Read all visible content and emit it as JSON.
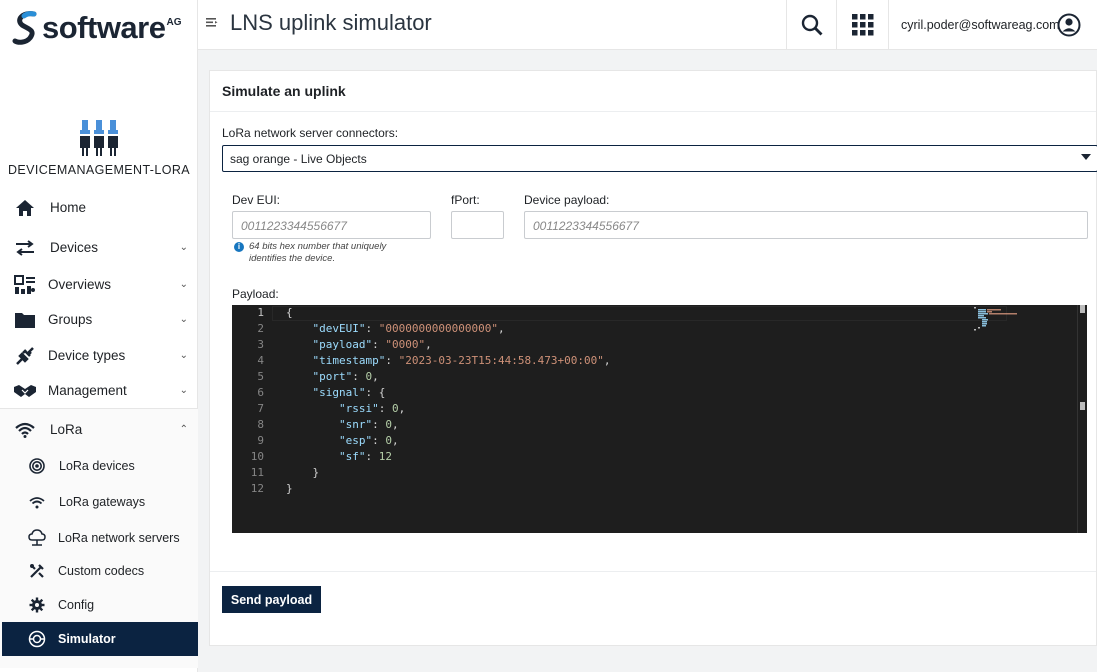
{
  "brand": {
    "name": "software",
    "suffix": "AG"
  },
  "app": {
    "name": "DEVICEMANAGEMENT-LORA"
  },
  "header": {
    "title": "LNS uplink simulator",
    "user_email": "cyril.poder@softwareag.com"
  },
  "sidebar": {
    "items": [
      {
        "label": "Home",
        "icon": "home-icon"
      },
      {
        "label": "Devices",
        "icon": "swap-arrows-icon"
      },
      {
        "label": "Overviews",
        "icon": "dashboard-icon"
      },
      {
        "label": "Groups",
        "icon": "folder-icon"
      },
      {
        "label": "Device types",
        "icon": "plug-icon"
      },
      {
        "label": "Management",
        "icon": "handshake-icon"
      },
      {
        "label": "LoRa",
        "icon": "wifi-icon"
      }
    ],
    "lora_items": [
      {
        "label": "LoRa devices",
        "icon": "target-icon"
      },
      {
        "label": "LoRa gateways",
        "icon": "wifi-icon"
      },
      {
        "label": "LoRa network servers",
        "icon": "cloud-icon"
      },
      {
        "label": "Custom codecs",
        "icon": "tools-icon"
      },
      {
        "label": "Config",
        "icon": "gear-icon"
      },
      {
        "label": "Simulator",
        "icon": "simulator-icon"
      }
    ]
  },
  "form": {
    "section_title": "Simulate an uplink",
    "connector_label": "LoRa network server connectors:",
    "connector_value": "sag orange - Live Objects",
    "dev_eui_label": "Dev EUI:",
    "dev_eui_placeholder": "0011223344556677",
    "dev_eui_hint": "64 bits hex number that uniquely identifies the device.",
    "fport_label": "fPort:",
    "fport_value": "",
    "payload_device_label": "Device payload:",
    "payload_device_placeholder": "0011223344556677",
    "payload_label": "Payload:",
    "send_label": "Send payload"
  },
  "editor": {
    "line_numbers": [
      "1",
      "2",
      "3",
      "4",
      "5",
      "6",
      "7",
      "8",
      "9",
      "10",
      "11",
      "12"
    ],
    "current_line": 1,
    "tokens": [
      [
        {
          "t": "p",
          "v": "{"
        }
      ],
      [
        {
          "t": "p",
          "v": "    "
        },
        {
          "t": "k",
          "v": "\"devEUI\""
        },
        {
          "t": "p",
          "v": ": "
        },
        {
          "t": "s",
          "v": "\"0000000000000000\""
        },
        {
          "t": "p",
          "v": ","
        }
      ],
      [
        {
          "t": "p",
          "v": "    "
        },
        {
          "t": "k",
          "v": "\"payload\""
        },
        {
          "t": "p",
          "v": ": "
        },
        {
          "t": "s",
          "v": "\"0000\""
        },
        {
          "t": "p",
          "v": ","
        }
      ],
      [
        {
          "t": "p",
          "v": "    "
        },
        {
          "t": "k",
          "v": "\"timestamp\""
        },
        {
          "t": "p",
          "v": ": "
        },
        {
          "t": "s",
          "v": "\"2023-03-23T15:44:58.473+00:00\""
        },
        {
          "t": "p",
          "v": ","
        }
      ],
      [
        {
          "t": "p",
          "v": "    "
        },
        {
          "t": "k",
          "v": "\"port\""
        },
        {
          "t": "p",
          "v": ": "
        },
        {
          "t": "n",
          "v": "0"
        },
        {
          "t": "p",
          "v": ","
        }
      ],
      [
        {
          "t": "p",
          "v": "    "
        },
        {
          "t": "k",
          "v": "\"signal\""
        },
        {
          "t": "p",
          "v": ": {"
        }
      ],
      [
        {
          "t": "p",
          "v": "        "
        },
        {
          "t": "k",
          "v": "\"rssi\""
        },
        {
          "t": "p",
          "v": ": "
        },
        {
          "t": "n",
          "v": "0"
        },
        {
          "t": "p",
          "v": ","
        }
      ],
      [
        {
          "t": "p",
          "v": "        "
        },
        {
          "t": "k",
          "v": "\"snr\""
        },
        {
          "t": "p",
          "v": ": "
        },
        {
          "t": "n",
          "v": "0"
        },
        {
          "t": "p",
          "v": ","
        }
      ],
      [
        {
          "t": "p",
          "v": "        "
        },
        {
          "t": "k",
          "v": "\"esp\""
        },
        {
          "t": "p",
          "v": ": "
        },
        {
          "t": "n",
          "v": "0"
        },
        {
          "t": "p",
          "v": ","
        }
      ],
      [
        {
          "t": "p",
          "v": "        "
        },
        {
          "t": "k",
          "v": "\"sf\""
        },
        {
          "t": "p",
          "v": ": "
        },
        {
          "t": "n",
          "v": "12"
        }
      ],
      [
        {
          "t": "p",
          "v": "    }"
        }
      ],
      [
        {
          "t": "p",
          "v": "}"
        }
      ]
    ]
  },
  "colors": {
    "brand_navy": "#0b2341",
    "info_blue": "#1776bf",
    "editor_bg": "#1e1e1e"
  }
}
